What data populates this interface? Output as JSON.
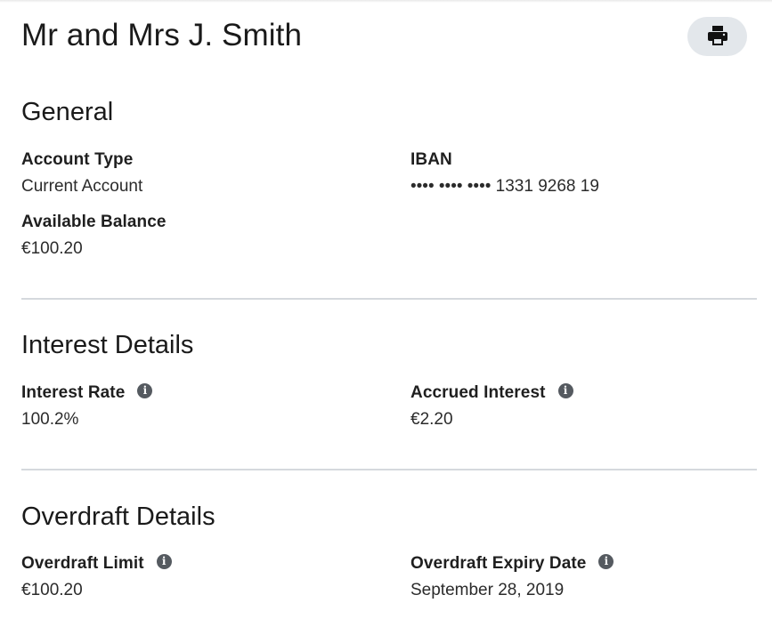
{
  "header": {
    "title": "Mr and Mrs J. Smith",
    "print_icon": "print-icon"
  },
  "general": {
    "title": "General",
    "account_type": {
      "label": "Account Type",
      "value": "Current Account"
    },
    "iban": {
      "label": "IBAN",
      "value": "•••• •••• •••• 1331 9268 19"
    },
    "available_balance": {
      "label": "Available Balance",
      "value": "€100.20"
    }
  },
  "interest": {
    "title": "Interest Details",
    "interest_rate": {
      "label": "Interest Rate",
      "value": "100.2%"
    },
    "accrued_interest": {
      "label": "Accrued Interest",
      "value": "€2.20"
    }
  },
  "overdraft": {
    "title": "Overdraft Details",
    "overdraft_limit": {
      "label": "Overdraft Limit",
      "value": "€100.20"
    },
    "overdraft_expiry": {
      "label": "Overdraft Expiry Date",
      "value": "September 28, 2019"
    }
  },
  "colors": {
    "print_button_bg": "#e3e7eb",
    "divider": "#d5d9dd",
    "info_icon": "#555a60"
  }
}
